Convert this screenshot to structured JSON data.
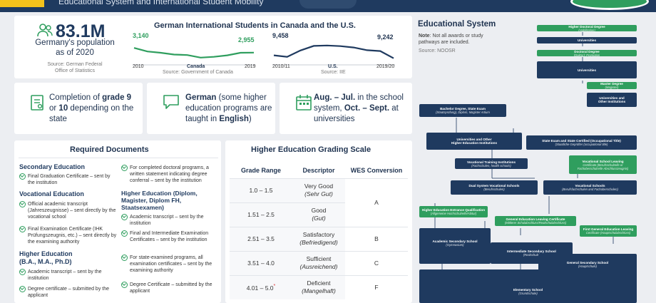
{
  "header": {
    "subtitle": "Educational System and International Student Mobility"
  },
  "population": {
    "value": "83.1M",
    "line1": "Germany's population",
    "line2": "as of 2020",
    "source1": "Source: German Federal",
    "source2": "Office of Statistics"
  },
  "students": {
    "title": "German International Students in Canada and the U.S.",
    "canada": {
      "start_value": "3,140",
      "end_value": "2,955",
      "start_year": "2010",
      "end_year": "2019",
      "label": "Canada",
      "source": "Source: Government of Canada"
    },
    "us": {
      "start_value": "9,458",
      "end_value": "9,242",
      "start_year": "2010/11",
      "end_year": "2019/20",
      "label": "U.S.",
      "source": "Source: IIE"
    }
  },
  "chart_data": [
    {
      "type": "line",
      "series": [
        {
          "name": "Canada",
          "x": [
            "2010",
            "2011",
            "2012",
            "2013",
            "2014",
            "2015",
            "2016",
            "2017",
            "2018",
            "2019"
          ],
          "values": [
            3140,
            3000,
            2950,
            2880,
            2860,
            2760,
            2790,
            2850,
            2950,
            2955
          ]
        }
      ]
    },
    {
      "type": "line",
      "series": [
        {
          "name": "U.S.",
          "x": [
            "2010/11",
            "2011/12",
            "2012/13",
            "2013/14",
            "2014/15",
            "2015/16",
            "2016/17",
            "2017/18",
            "2018/19",
            "2019/20"
          ],
          "values": [
            9458,
            9347,
            9819,
            10160,
            10193,
            10145,
            10042,
            9843,
            9775,
            9242
          ]
        }
      ]
    }
  ],
  "info": {
    "grade": {
      "p1": "Completion of ",
      "b1": "grade 9",
      "p2": " or ",
      "b2": "10",
      "p3": " depending on the state"
    },
    "language": {
      "b1": "German",
      "p1": " (some higher education programs are taught in ",
      "b2": "English",
      "p2": ")"
    },
    "calendar": {
      "b1": "Aug. – Jul.",
      "p1": " in the school system, ",
      "b2": "Oct. – Sept.",
      "p2": " at universities"
    }
  },
  "documents": {
    "title": "Required Documents",
    "secondary": {
      "heading": "Secondary Education",
      "items": [
        "Final Graduation Certificate – sent by the institution"
      ]
    },
    "vocational": {
      "heading": "Vocational Education",
      "items": [
        "Official academic transcript (Jahreszeugnisse) – sent directly by the vocational school",
        "Final Examination Certificate (IHK Prüfungszeugnis, etc.) – sent directly by the examining authority"
      ]
    },
    "higher1": {
      "heading": "Higher Education",
      "heading2": "(B.A., M.A., Ph.D)",
      "items": [
        "Academic transcript – sent by the institution",
        "Degree certificate – submitted by the applicant"
      ]
    },
    "doctoral": {
      "items": [
        "For completed doctoral programs, a written statement indicating degree conferral – sent by the institution"
      ]
    },
    "higher2": {
      "heading": "Higher Education (Diplom,",
      "heading2": "Magister, Diplom FH,",
      "heading3": "Staatsexamen)",
      "items": [
        "Academic transcript – sent by the institution",
        "Final and Intermediate Examination Certificates – sent by the institution",
        "For state-examined programs, all examination certificates – sent by the examining authority",
        "Degree Certificate – submitted by the applicant"
      ]
    }
  },
  "grading": {
    "title": "Higher Education Grading Scale",
    "headers": [
      "Grade Range",
      "Descriptor",
      "WES Conversion"
    ],
    "rows": [
      {
        "range": "1.0 – 1.5",
        "desc": "Very Good",
        "desc_de": "(Sehr Gut)",
        "wes": ""
      },
      {
        "range": "1.51 – 2.5",
        "desc": "Good",
        "desc_de": "(Gut)",
        "wes": "A"
      },
      {
        "range": "2.51 – 3.5",
        "desc": "Satisfactory",
        "desc_de": "(Befriedigend)",
        "wes": "B"
      },
      {
        "range": "3.51 – 4.0",
        "desc": "Sufficient",
        "desc_de": "(Ausreichend)",
        "wes": "C"
      },
      {
        "range": "4.01 – 5.0",
        "star": "*",
        "desc": "Deficient",
        "desc_de": "(Mangelhaft)",
        "wes": "F"
      }
    ]
  },
  "edu_system": {
    "title": "Educational System",
    "note_label": "Note",
    "note_text": ": Not all awards or study pathways are included.",
    "source": "Source: NOOSR",
    "nodes": {
      "hdd": {
        "t": "Higher Doctoral Degree",
        "s": "(Habilitation)"
      },
      "uni1": {
        "t": "Universities",
        "s": ""
      },
      "doc": {
        "t": "Doctoral Degree",
        "s": "(Doktor); Promotion"
      },
      "uni2": {
        "t": "Universities",
        "s": ""
      },
      "master": {
        "t": "Master Degree",
        "s": "(Magister)"
      },
      "unio": {
        "t": "Universities and",
        "s": "Other Institutions"
      },
      "bach": {
        "t": "Bachelor Degree, State Exam",
        "s": "(Staatsprüfung), Diplom, Magister Artium"
      },
      "uhei": {
        "t": "Universities and Other",
        "s": "Higher Education Institutions"
      },
      "state": {
        "t": "State Exam and State Certified (Occupational Title)",
        "s": "(Staatliche Geprüfter (occupational title)"
      },
      "vti": {
        "t": "Vocational Training Institutions",
        "s": "(Fachschulen, health schools)"
      },
      "vslc": {
        "t": "Vocational School Leaving",
        "s": "Certificate (Berufsschulreife or Fachoberschulreife Abschlusszeugnis)"
      },
      "dual": {
        "t": "Dual System Vocational Schools",
        "s": "(Berufsschulen)"
      },
      "voc": {
        "t": "Vocational Schools",
        "s": "(Berufsfachschulen and Fachoberschulen)"
      },
      "hee": {
        "t": "Higher Education Entrance Qualification",
        "s": "(Allgemeine Hochschulreife/Abitur)"
      },
      "gelc1": {
        "t": "General Education Leaving Certificate",
        "s": "(Mittlerer Schulabschluss/Realschulabschluss)"
      },
      "fgelc": {
        "t": "First General Education Leaving",
        "s": "Certificate (Hauptschulabschluss)"
      },
      "ass": {
        "t": "Academic Secondary School",
        "s": "(Gymnasium)"
      },
      "iss": {
        "t": "Intermediate Secondary School",
        "s": "(Realschule)"
      },
      "gss": {
        "t": "General Secondary School",
        "s": "(Hauptschule)"
      },
      "elem": {
        "t": "Elementary School",
        "s": "(Grundschule)"
      }
    }
  },
  "colors": {
    "navy": "#1f3a5f",
    "green": "#2f9e5e",
    "yellow": "#f4c21b"
  },
  "icons": [
    "people-icon",
    "diploma-icon",
    "speech-bubble-icon",
    "calendar-icon"
  ]
}
